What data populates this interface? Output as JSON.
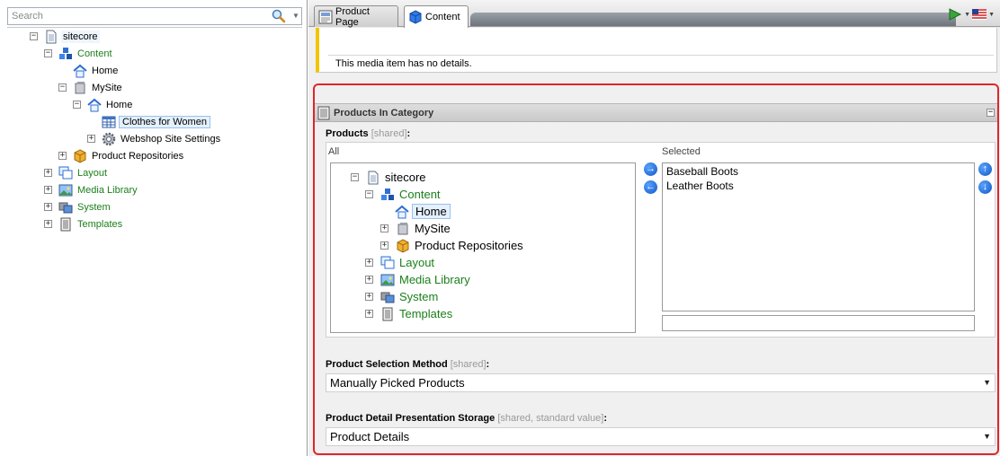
{
  "search": {
    "placeholder": "Search"
  },
  "sidebar_tree": [
    {
      "label": "sitecore"
    },
    {
      "label": "Content"
    },
    {
      "label": "Home"
    },
    {
      "label": "MySite"
    },
    {
      "label": "Home"
    },
    {
      "label": "Clothes for Women"
    },
    {
      "label": "Webshop Site Settings"
    },
    {
      "label": "Product Repositories"
    },
    {
      "label": "Layout"
    },
    {
      "label": "Media Library"
    },
    {
      "label": "System"
    },
    {
      "label": "Templates"
    }
  ],
  "tabs": [
    {
      "label": "Product Page"
    },
    {
      "label": "Content"
    }
  ],
  "media": {
    "message": "This media item has no details."
  },
  "section": {
    "title": "Products In Category",
    "products_field": {
      "label": "Products",
      "meta": "[shared]",
      "colon": ":"
    },
    "all_label": "All",
    "selected_label": "Selected",
    "all_tree": [
      {
        "label": "sitecore"
      },
      {
        "label": "Content"
      },
      {
        "label": "Home"
      },
      {
        "label": "MySite"
      },
      {
        "label": "Product Repositories"
      },
      {
        "label": "Layout"
      },
      {
        "label": "Media Library"
      },
      {
        "label": "System"
      },
      {
        "label": "Templates"
      }
    ],
    "selected_items": [
      "Baseball Boots",
      "Leather Boots"
    ],
    "selection_method": {
      "label": "Product Selection Method",
      "meta": "[shared]",
      "colon": ":",
      "value": "Manually Picked Products"
    },
    "presentation_storage": {
      "label": "Product Detail Presentation Storage",
      "meta": "[shared, standard value]",
      "colon": ":",
      "value": "Product Details"
    }
  }
}
